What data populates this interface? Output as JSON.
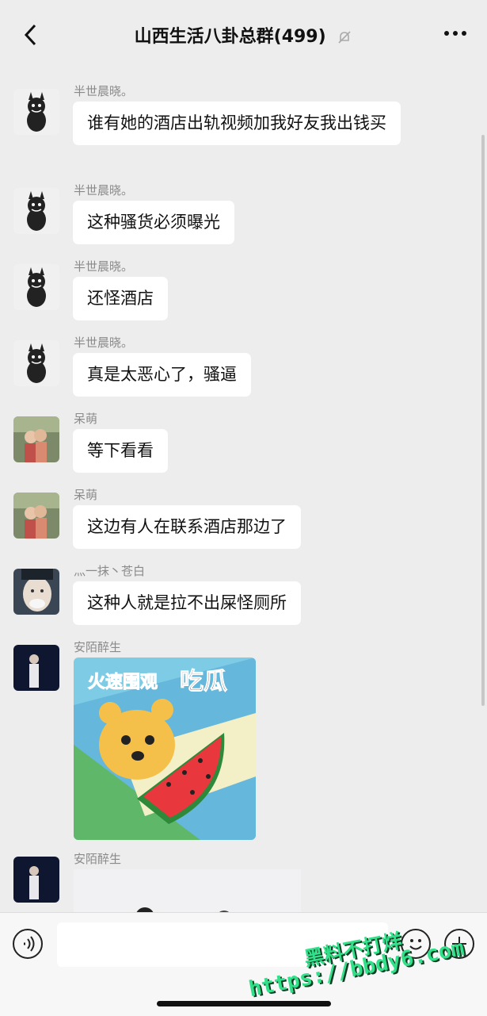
{
  "header": {
    "title": "山西生活八卦总群(499)",
    "back_icon": "chevron-left-icon",
    "mute_icon": "bell-off-icon",
    "more_icon": "more-dots-icon"
  },
  "messages": [
    {
      "sender": "半世晨晓。",
      "text": "谁有她的酒店出轨视频加我好友我出钱买",
      "avatar": "black-cat"
    },
    {
      "sender": "半世晨晓。",
      "text": "这种骚货必须曝光",
      "avatar": "black-cat"
    },
    {
      "sender": "半世晨晓。",
      "text": "还怪酒店",
      "avatar": "black-cat"
    },
    {
      "sender": "半世晨晓。",
      "text": "真是太恶心了，骚逼",
      "avatar": "black-cat"
    },
    {
      "sender": "呆萌",
      "text": "等下看看",
      "avatar": "couple"
    },
    {
      "sender": "呆萌",
      "text": "这边有人在联系酒店那边了",
      "avatar": "couple"
    },
    {
      "sender": "灬一抹丶苍白",
      "text": "这种人就是拉不出屎怪厕所",
      "avatar": "face"
    },
    {
      "sender": "安陌醉生",
      "sticker_text_1": "火速围观",
      "sticker_text_2": "吃瓜",
      "avatar": "dark-portrait"
    },
    {
      "sender": "安陌醉生",
      "avatar": "dark-portrait"
    }
  ],
  "input": {
    "voice_icon": "voice-icon",
    "emoji_icon": "emoji-icon",
    "plus_icon": "plus-icon"
  },
  "watermark": {
    "line1": "黑料不打烊",
    "line2": "https://bbdy6.com"
  }
}
